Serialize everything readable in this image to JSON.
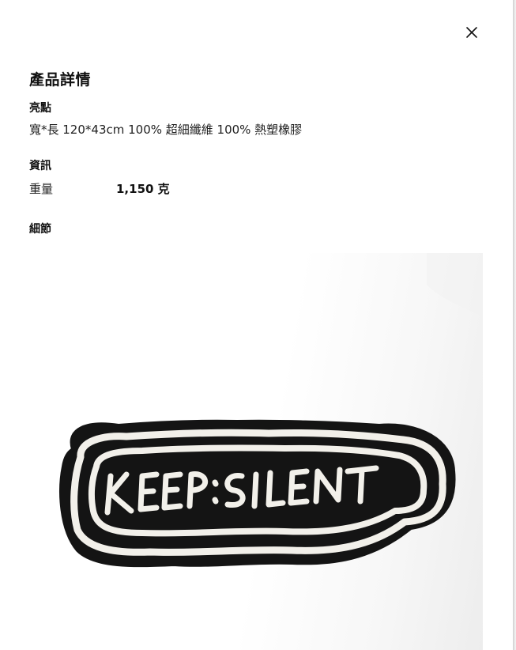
{
  "close": {
    "icon": "close-icon"
  },
  "product_details": {
    "heading": "產品詳情",
    "highlights": {
      "title": "亮點",
      "text": "寬*長 120*43cm 100% 超細纖維 100% 熱塑橡膠"
    },
    "info": {
      "title": "資訊",
      "weight_label": "重量",
      "weight_value": "1,150 克"
    },
    "details": {
      "title": "細節"
    }
  },
  "product_image": {
    "rug_text": "KEEP:SILENT",
    "colors": {
      "rug_black": "#141414",
      "rug_white": "#f2f0ea",
      "background": "#ffffff"
    }
  }
}
